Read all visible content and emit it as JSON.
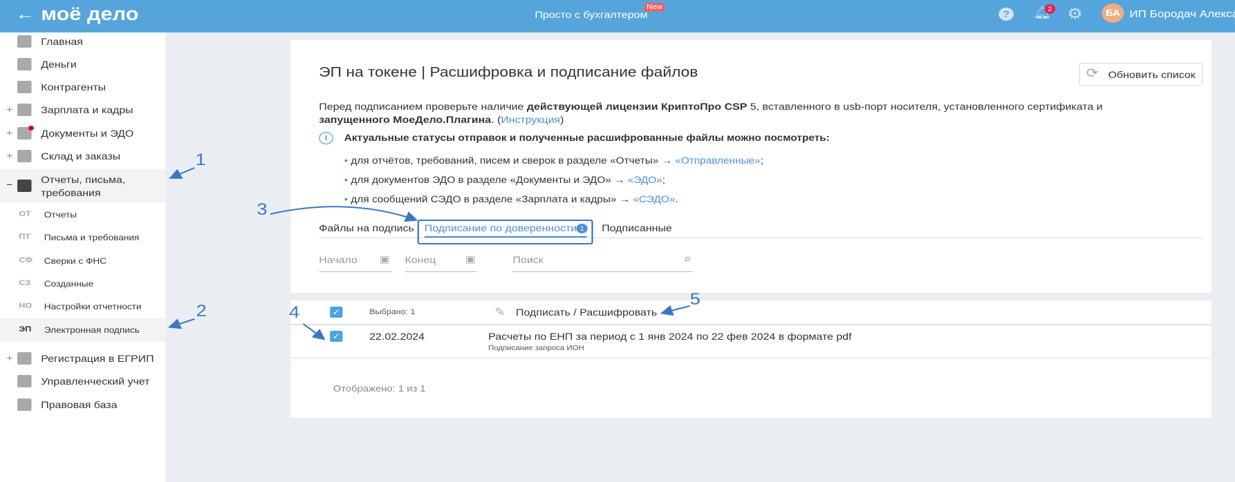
{
  "header": {
    "logo": "моё дело",
    "promo": "Просто с бухгалтером",
    "promo_badge": "New",
    "notifications": "2",
    "avatar": "БА",
    "user": "ИП Бородач Александ"
  },
  "sidebar": {
    "items": [
      {
        "label": "Главная",
        "icon": "home-icon"
      },
      {
        "label": "Деньги",
        "icon": "money-icon"
      },
      {
        "label": "Контрагенты",
        "icon": "contractors-icon"
      },
      {
        "label": "Зарплата и кадры",
        "icon": "salary-icon",
        "expand": "+"
      },
      {
        "label": "Документы и ЭДО",
        "icon": "documents-icon",
        "expand": "+"
      },
      {
        "label": "Склад и заказы",
        "icon": "warehouse-icon",
        "expand": "+"
      }
    ],
    "group": {
      "label": "Отчеты, письма, требования",
      "collapse": "−"
    },
    "subitems": [
      {
        "abbr": "ОТ",
        "label": "Отчеты"
      },
      {
        "abbr": "ПТ",
        "label": "Письма и требования"
      },
      {
        "abbr": "СФ",
        "label": "Сверки с ФНС"
      },
      {
        "abbr": "СЗ",
        "label": "Созданные"
      },
      {
        "abbr": "НО",
        "label": "Настройки отчетности"
      },
      {
        "abbr": "ЭП",
        "label": "Электронная подпись"
      }
    ],
    "bottom": [
      {
        "label": "Регистрация в ЕГРИП",
        "expand": "+"
      },
      {
        "label": "Управленческий учет"
      },
      {
        "label": "Правовая база"
      }
    ]
  },
  "page": {
    "title": "ЭП на токене | Расшифровка и подписание файлов",
    "refresh": "Обновить список",
    "intro": {
      "t1": "Перед подписанием проверьте наличие ",
      "b1": "действующей лицензии КриптоПро CSP",
      "t2": " 5, вставленного в usb-порт носителя, установленного сертификата и ",
      "b2": "запущенного МоеДело.Плагина",
      "t3": ". (",
      "link": "Инструкция",
      "t4": ")"
    },
    "info": "Актуальные статусы отправок и полученные расшифрованные файлы можно посмотреть:",
    "bullets": [
      {
        "text": "для отчётов, требований, писем и сверок в разделе «Отчеты» → ",
        "link": "«Отправленные»",
        "end": ";"
      },
      {
        "text": "для документов ЭДО в разделе «Документы и ЭДО» → ",
        "link": "«ЭДО»",
        "end": ";"
      },
      {
        "text": "для сообщений СЭДО в разделе «Зарплата и кадры» → ",
        "link": "«СЭДО»",
        "end": "."
      }
    ],
    "tabs": [
      {
        "label": "Файлы на подпись"
      },
      {
        "label": "Подписание по доверенности",
        "badge": "1"
      },
      {
        "label": "Подписанные"
      }
    ],
    "filters": {
      "start": "Начало",
      "end": "Конец",
      "search": "Поиск"
    }
  },
  "table": {
    "selected": "Выбрано: 1",
    "action": "Подписать / Расшифровать",
    "rows": [
      {
        "date": "22.02.2024",
        "title": "Расчеты по ЕНП за период с 1 янв 2024 по 22 фев 2024 в формате pdf",
        "subtitle": "Подписание запроса ИОН",
        "checked": true
      }
    ],
    "footer": "Отображено: 1 из 1"
  },
  "annotations": [
    "1",
    "2",
    "3",
    "4",
    "5"
  ]
}
